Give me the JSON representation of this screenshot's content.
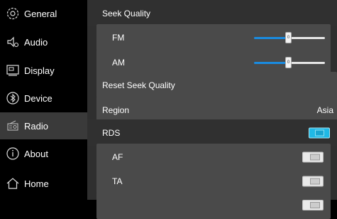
{
  "sidebar": {
    "items": [
      {
        "label": "General",
        "icon": "gear-icon"
      },
      {
        "label": "Audio",
        "icon": "speaker-icon"
      },
      {
        "label": "Display",
        "icon": "display-icon"
      },
      {
        "label": "Device",
        "icon": "bluetooth-icon"
      },
      {
        "label": "Radio",
        "icon": "radio-icon"
      },
      {
        "label": "About",
        "icon": "info-icon"
      },
      {
        "label": "Home",
        "icon": "home-icon"
      }
    ],
    "active": "Radio"
  },
  "content": {
    "seek_quality_header": "Seek Quality",
    "fm": {
      "label": "FM",
      "slider_value_label": "0",
      "level_percent": 48
    },
    "am": {
      "label": "AM",
      "slider_value_label": "0",
      "level_percent": 48
    },
    "reset_label": "Reset Seek Quality",
    "region": {
      "label": "Region",
      "value": "Asia"
    },
    "rds_header": "RDS",
    "rds_enabled": true,
    "af": {
      "label": "AF",
      "enabled": false
    },
    "ta": {
      "label": "TA",
      "enabled": false
    }
  },
  "colors": {
    "accent_blue": "#1a8be0",
    "toggle_on": "#20b9e6",
    "panel_bg": "#2f2f2f",
    "card_bg": "#4a4a4a",
    "active_nav_bg": "#3a3a3a"
  }
}
